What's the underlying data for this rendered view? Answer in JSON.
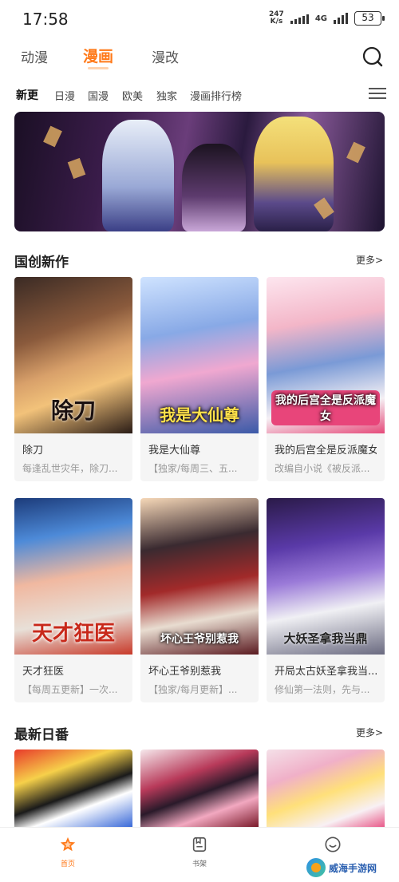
{
  "status_bar": {
    "time": "17:58",
    "net_speed_value": "247",
    "net_speed_unit": "K/s",
    "network": "4G",
    "battery": "53"
  },
  "top_tabs": [
    {
      "label": "动漫",
      "active": false
    },
    {
      "label": "漫画",
      "active": true
    },
    {
      "label": "漫改",
      "active": false
    }
  ],
  "sub_tabs": [
    {
      "label": "新更",
      "active": true
    },
    {
      "label": "日漫",
      "active": false
    },
    {
      "label": "国漫",
      "active": false
    },
    {
      "label": "欧美",
      "active": false
    },
    {
      "label": "独家",
      "active": false
    },
    {
      "label": "漫画排行榜",
      "active": false
    }
  ],
  "sections": [
    {
      "title": "国创新作",
      "more": "更多>",
      "items": [
        {
          "title": "除刀",
          "desc": "每逢乱世灾年，除刀...",
          "cover_text": "除刀"
        },
        {
          "title": "我是大仙尊",
          "desc": "【独家/每周三、五...",
          "cover_text": "我是大仙尊"
        },
        {
          "title": "我的后宫全是反派魔女",
          "desc": "改编自小说《被反派...",
          "cover_text": "我的后宫全是反派魔女"
        },
        {
          "title": "天才狂医",
          "desc": "【每周五更新】一次...",
          "cover_text": "天才狂医"
        },
        {
          "title": "坏心王爷别惹我",
          "desc": "【独家/每月更新】...",
          "cover_text": "坏心王爷别惹我"
        },
        {
          "title": "开局太古妖圣拿我当...",
          "desc": "修仙第一法则，先与...",
          "cover_text": "大妖圣拿我当鼎"
        }
      ]
    },
    {
      "title": "最新日番",
      "more": "更多>"
    }
  ],
  "bottom_nav": [
    {
      "label": "首页",
      "icon": "star-home-icon",
      "active": true
    },
    {
      "label": "书架",
      "icon": "bookshelf-icon",
      "active": false
    },
    {
      "label": "",
      "icon": "smiley-profile-icon",
      "active": false
    }
  ],
  "watermark": "威海手游网",
  "colors": {
    "accent": "#ff7a1a",
    "card_bg": "#f5f5f5",
    "muted_text": "#999999"
  }
}
